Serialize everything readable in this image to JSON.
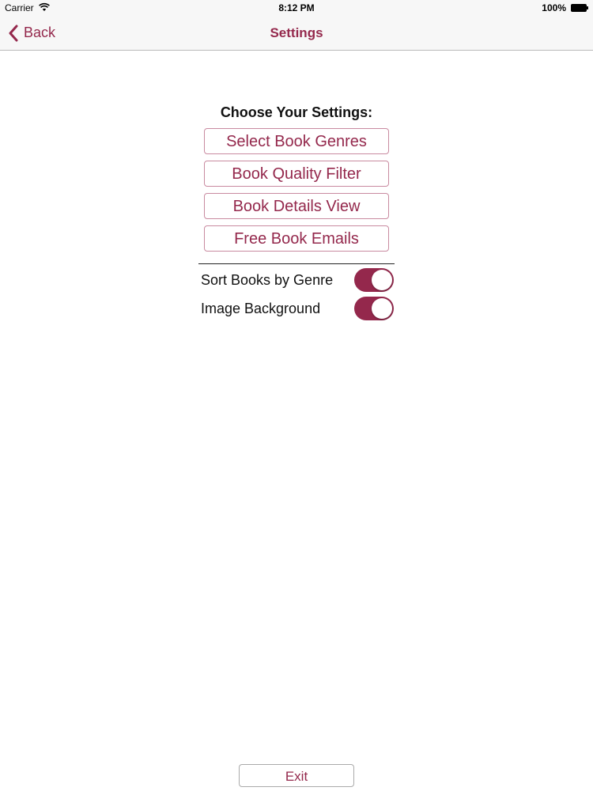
{
  "status_bar": {
    "carrier": "Carrier",
    "wifi_icon": "wifi-icon",
    "time": "8:12 PM",
    "battery_percent": "100%",
    "battery_icon": "battery-icon"
  },
  "nav_bar": {
    "back_label": "Back",
    "back_icon": "chevron-left-icon",
    "title": "Settings"
  },
  "settings": {
    "heading": "Choose Your Settings:",
    "buttons": [
      {
        "label": "Select Book Genres"
      },
      {
        "label": "Book Quality Filter"
      },
      {
        "label": "Book Details View"
      },
      {
        "label": "Free Book Emails"
      }
    ],
    "toggles": [
      {
        "label": "Sort Books by Genre",
        "on": true
      },
      {
        "label": "Image Background",
        "on": true
      }
    ]
  },
  "footer": {
    "exit_label": "Exit"
  },
  "colors": {
    "accent": "#94284c",
    "nav_background": "#f7f7f7",
    "button_border": "#c98aa0"
  }
}
